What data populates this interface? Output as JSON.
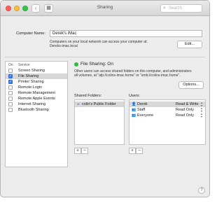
{
  "window": {
    "title": "Sharing",
    "search_placeholder": "Search"
  },
  "computer_name": {
    "label": "Computer Name:",
    "value": "Derek's iMac",
    "note_line1": "Computers on your local network can access your computer at:",
    "note_line2": "Dereks-imac.local",
    "edit_button": "Edit..."
  },
  "services": {
    "header_on": "On",
    "header_service": "Service",
    "items": [
      {
        "name": "Screen Sharing",
        "checked": false,
        "selected": false
      },
      {
        "name": "File Sharing",
        "checked": true,
        "selected": true
      },
      {
        "name": "Printer Sharing",
        "checked": true,
        "selected": false
      },
      {
        "name": "Remote Login",
        "checked": false,
        "selected": false
      },
      {
        "name": "Remote Management",
        "checked": false,
        "selected": false
      },
      {
        "name": "Remote Apple Events",
        "checked": false,
        "selected": false
      },
      {
        "name": "Internet Sharing",
        "checked": false,
        "selected": false
      },
      {
        "name": "Bluetooth Sharing",
        "checked": false,
        "selected": false
      }
    ]
  },
  "file_sharing": {
    "status": "File Sharing: On",
    "status_color": "#2dbd3a",
    "description_line1": "Other users can access shared folders on this computer, and administrators",
    "description_line2": "all volumes, at \"afp://colins-imac.home\" or \"smb://colins-imac.home\".",
    "options_button": "Options..."
  },
  "shared_folders": {
    "label": "Shared Folders:",
    "items": [
      "colin's Public Folder"
    ],
    "add": "+",
    "remove": "−"
  },
  "users": {
    "label": "Users:",
    "items": [
      {
        "name": "Derek",
        "access": "Read & Write"
      },
      {
        "name": "Staff",
        "access": "Read Only"
      },
      {
        "name": "Everyone",
        "access": "Read Only"
      }
    ],
    "add": "+",
    "remove": "−"
  },
  "help": "?",
  "accent_color": "#2e7cf6"
}
